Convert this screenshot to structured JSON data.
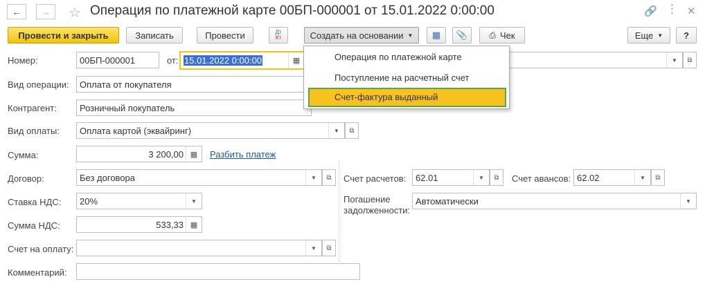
{
  "window": {
    "title": "Операция по платежной карте 00БП-000001 от 15.01.2022 0:00:00"
  },
  "icons": {
    "back": "arrow-left-icon",
    "forward": "arrow-right-icon",
    "favorite": "star-icon",
    "link": "link-icon",
    "more": "more-dots-icon",
    "close": "close-icon"
  },
  "toolbar": {
    "post_and_close": "Провести и закрыть",
    "save": "Записать",
    "post": "Провести",
    "dt_kt": "Дт Кт",
    "create_based_on": "Создать на основании",
    "check": "Чек",
    "more": "Еще",
    "help": "?"
  },
  "menu": {
    "items": [
      {
        "label": "Операция по платежной карте"
      },
      {
        "label": "Поступление на расчетный счет"
      },
      {
        "label": "Счет-фактура выданный"
      }
    ]
  },
  "form": {
    "number_label": "Номер:",
    "number_value": "00БП-000001",
    "from_label": "от:",
    "date_value": "15.01.2022  0:00:00",
    "operation_label": "Вид операции:",
    "operation_value": "Оплата от покупателя",
    "counterparty_label": "Контрагент:",
    "counterparty_value": "Розничный покупатель",
    "payment_type_label": "Вид оплаты:",
    "payment_type_value": "Оплата картой (эквайринг)",
    "amount_label": "Сумма:",
    "amount_value": "3 200,00",
    "split_payment_link": "Разбить платеж",
    "contract_label": "Договор:",
    "contract_value": "Без договора",
    "vat_rate_label": "Ставка НДС:",
    "vat_rate_value": "20%",
    "vat_amount_label": "Сумма НДС:",
    "vat_amount_value": "533,33",
    "invoice_label": "Счет на оплату:",
    "invoice_value": "",
    "comment_label": "Комментарий:",
    "comment_value": "",
    "settlement_account_label": "Счет расчетов:",
    "settlement_account_value": "62.01",
    "advance_account_label": "Счет авансов:",
    "advance_account_value": "62.02",
    "debt_repayment_label_1": "Погашение",
    "debt_repayment_label_2": "задолженности:",
    "debt_repayment_value": "Автоматически"
  },
  "colors": {
    "primary_button": "#f2c20c",
    "menu_highlight": "#f7c11f",
    "menu_highlight_border": "#55a843",
    "link": "#1b56a8",
    "date_selection": "#3a6fd8"
  }
}
